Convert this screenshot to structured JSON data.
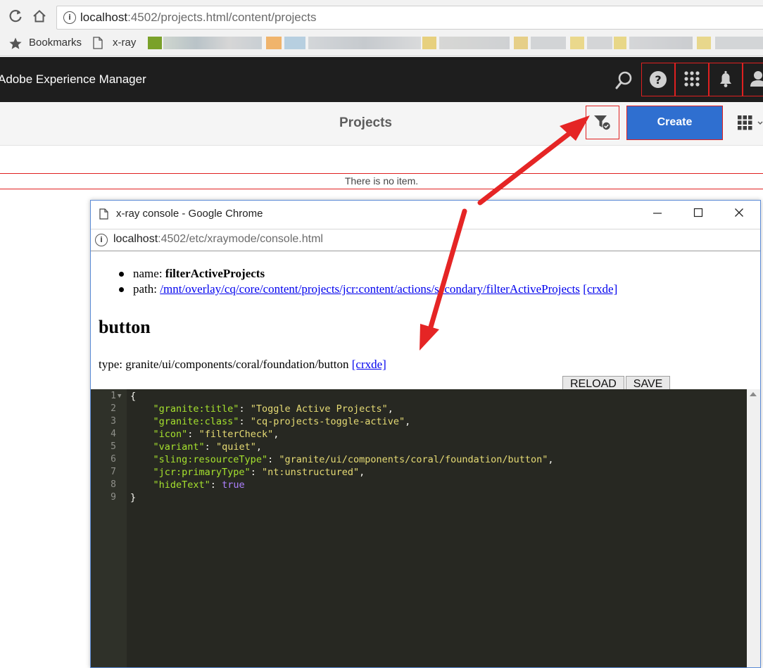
{
  "browser": {
    "url_host": "localhost",
    "url_rest": ":4502/projects.html/content/projects",
    "bookmarks": [
      {
        "label": "Bookmarks",
        "icon": "star-icon"
      },
      {
        "label": "x-ray",
        "icon": "page-icon"
      }
    ]
  },
  "aem": {
    "title": "Adobe Experience Manager",
    "header_icons": [
      "search-icon",
      "help-icon",
      "apps-icon",
      "bell-icon",
      "user-icon"
    ]
  },
  "action_bar": {
    "title": "Projects",
    "create_label": "Create"
  },
  "list": {
    "empty_message": "There is no item."
  },
  "popup": {
    "window_title": "x-ray console - Google Chrome",
    "url_host": "localhost",
    "url_rest": ":4502/etc/xraymode/console.html",
    "name_label": "name: ",
    "name_value": "filterActiveProjects",
    "path_label": "path: ",
    "path_value": "/mnt/overlay/cq/core/content/projects/jcr:content/actions/secondary/filterActiveProjects",
    "crxde_label": "[crxde]",
    "heading": "button",
    "type_label": "type: granite/ui/components/coral/foundation/button",
    "reload_label": "RELOAD",
    "save_label": "SAVE"
  },
  "code": {
    "line_numbers": [
      "1",
      "2",
      "3",
      "4",
      "5",
      "6",
      "7",
      "8",
      "9"
    ],
    "open_brace": "{",
    "close_brace": "}",
    "entries": [
      {
        "key": "\"granite:title\"",
        "value": "\"Toggle Active Projects\"",
        "kind": "string",
        "comma": ","
      },
      {
        "key": "\"granite:class\"",
        "value": "\"cq-projects-toggle-active\"",
        "kind": "string",
        "comma": ","
      },
      {
        "key": "\"icon\"",
        "value": "\"filterCheck\"",
        "kind": "string",
        "comma": ","
      },
      {
        "key": "\"variant\"",
        "value": "\"quiet\"",
        "kind": "string",
        "comma": ","
      },
      {
        "key": "\"sling:resourceType\"",
        "value": "\"granite/ui/components/coral/foundation/button\"",
        "kind": "string",
        "comma": ","
      },
      {
        "key": "\"jcr:primaryType\"",
        "value": "\"nt:unstructured\"",
        "kind": "string",
        "comma": ","
      },
      {
        "key": "\"hideText\"",
        "value": "true",
        "kind": "bool",
        "comma": ""
      }
    ]
  },
  "colors": {
    "highlight_red": "#e02020",
    "create_blue": "#2f6fd0",
    "editor_bg": "#272822"
  }
}
